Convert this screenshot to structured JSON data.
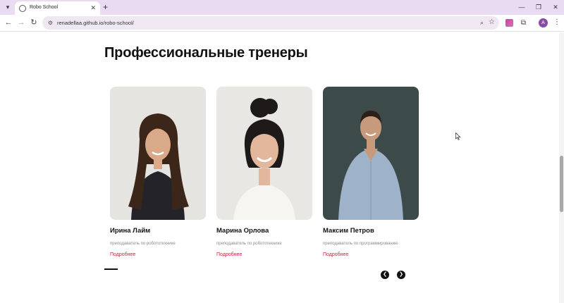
{
  "browser": {
    "tab_title": "Robo School",
    "url": "renadellaa.github.io/robo-school/",
    "profile_initial": "A",
    "icons": [
      "tab-list-icon",
      "favicon-icon",
      "close-icon",
      "new-tab-icon",
      "minimize-icon",
      "restore-icon",
      "back-icon",
      "forward-icon",
      "reload-icon",
      "site-info-icon",
      "zoom-icon",
      "star-icon",
      "extension-icon",
      "puzzle-icon",
      "kebab-menu-icon"
    ]
  },
  "section": {
    "title": "Профессиональные тренеры"
  },
  "trainers": [
    {
      "name": "Ирина Лайм",
      "role": "преподаватель по робототехнике",
      "link": "Подробнее"
    },
    {
      "name": "Марина Орлова",
      "role": "преподаватель по робототехнике",
      "link": "Подробнее"
    },
    {
      "name": "Максим Петров",
      "role": "преподаватель по программированию",
      "link": "Подробнее"
    }
  ],
  "slider": {
    "prev_icon": "arrow-left-icon",
    "next_icon": "arrow-right-icon",
    "prev_glyph": "❮",
    "next_glyph": "❯"
  },
  "colors": {
    "link": "#c0233b",
    "tabbar": "#e9dcf2",
    "avatar": "#8a4aa8"
  }
}
